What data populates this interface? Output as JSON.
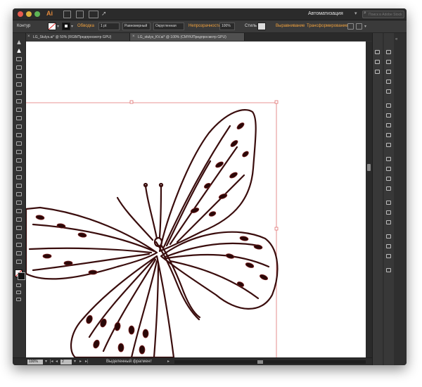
{
  "app": {
    "logo": "Ai",
    "workspace": "Автоматизация",
    "search_placeholder": "Поиск в Adobe Stock"
  },
  "controlbar": {
    "selection_label": "Контур",
    "stroke_label": "Обводка",
    "stroke_weight": "1 pt",
    "stroke_profile": "Равномерный",
    "brush": "Округленная",
    "opacity_label": "Непрозрачность",
    "opacity_value": "100%",
    "style_label": "Стиль",
    "align_label": "Выравнивание",
    "transform_label": "Трансформирование"
  },
  "tabs": [
    {
      "label": "LG_Stulys.ai* @ 50% (RGB/Предпросмотр GPU)",
      "active": false
    },
    {
      "label": "LG_stulys_KV.ai* @ 100% (CMYK/Предпросмотр GPU)",
      "active": true
    }
  ],
  "status": {
    "zoom": "100%",
    "page": "2",
    "status_text": "Выделенный фрагмент"
  },
  "colors": {
    "stroke": "#3a0d0d",
    "selection": "#e07070",
    "accent": "#f0a13d"
  }
}
